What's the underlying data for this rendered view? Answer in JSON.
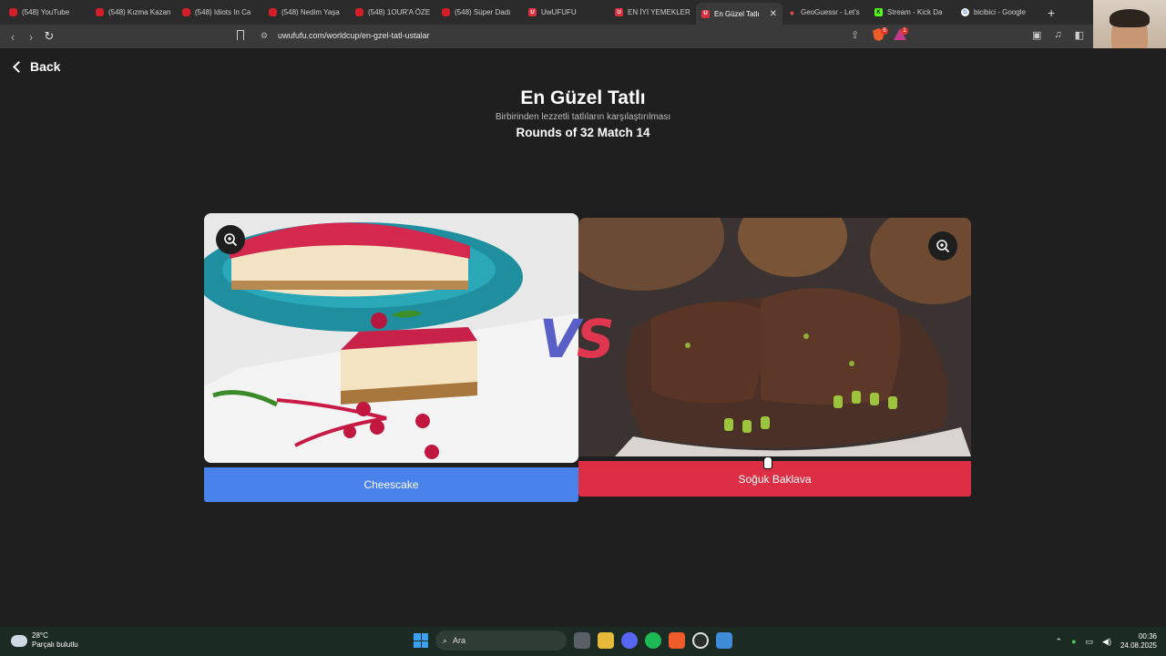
{
  "browser": {
    "tabs": [
      {
        "label": "(548) YouTube",
        "icon": "youtube-icon"
      },
      {
        "label": "(548) Kızma Kazan",
        "icon": "youtube-icon"
      },
      {
        "label": "(548) Idiots In Ca",
        "icon": "youtube-icon"
      },
      {
        "label": "(548) Nedim Yaşa",
        "icon": "youtube-icon"
      },
      {
        "label": "(548) 1OUR'A ÖZE",
        "icon": "youtube-icon"
      },
      {
        "label": "(548) Süper Dadı",
        "icon": "youtube-icon"
      },
      {
        "label": "UwUFUFU",
        "icon": "uwufufu-icon"
      },
      {
        "label": "EN İYİ YEMEKLER",
        "icon": "uwufufu-icon"
      },
      {
        "label": "En Güzel Tatlı",
        "icon": "uwufufu-icon"
      },
      {
        "label": "GeoGuessr - Let's",
        "icon": "geoguessr-icon"
      },
      {
        "label": "Stream - Kick Da",
        "icon": "kick-icon"
      },
      {
        "label": "bicibici - Google",
        "icon": "google-icon"
      }
    ],
    "active_tab_index": 8,
    "close_glyph": "✕",
    "new_tab_glyph": "+",
    "url": "uwufufu.com/worldcup/en-gzel-tatl-ustalar",
    "brave_badge": "6",
    "rewards_badge": "1"
  },
  "page": {
    "back_label": "Back",
    "title": "En Güzel Tatlı",
    "subtitle": "Birbirinden lezzetli tatlıların karşılaştırılması",
    "round_info": "Rounds of 32 Match 14",
    "vs_v": "V",
    "vs_s": "S",
    "left_choice": "Cheescake",
    "right_choice": "Soğuk Baklava",
    "left_accent": "#4a82ec",
    "right_accent": "#dc2f45"
  },
  "taskbar": {
    "temperature": "28°C",
    "weather_desc": "Parçalı bulutlu",
    "search_placeholder": "Ara",
    "time": "00:36",
    "date": "24.08.2025"
  }
}
